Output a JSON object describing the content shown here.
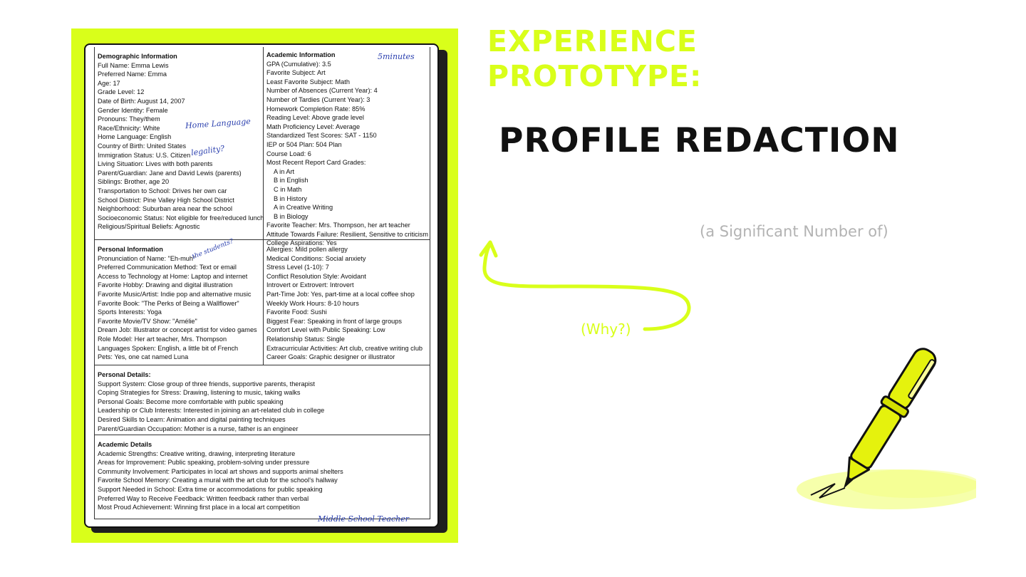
{
  "slide": {
    "title_line1": "EXPERIENCE",
    "title_line2": "PROTOTYPE:",
    "heading": "PROFILE REDACTION",
    "subtitle": "(a Significant Number of)",
    "why": "(Why?)",
    "accent_color": "#d9ff1a"
  },
  "doc": {
    "handwriting": {
      "time": "5minutes",
      "home_language": "Home Language",
      "legality": "legality?",
      "the_students": "the students?",
      "role": "Middle School Teacher"
    },
    "demographic": {
      "title": "Demographic Information",
      "lines": [
        "Full Name: Emma Lewis",
        "Preferred Name: Emma",
        "Age: 17",
        "Grade Level: 12",
        "Date of Birth: August 14, 2007",
        "Gender Identity: Female",
        "Pronouns: They/them",
        "Race/Ethnicity: White",
        "Home Language: English",
        "Country of Birth: United States",
        "Immigration Status: U.S. Citizen",
        "Living Situation: Lives with both parents",
        "Parent/Guardian: Jane and David Lewis (parents)",
        "Siblings: Brother, age 20",
        "Transportation to School: Drives her own car",
        "School District: Pine Valley High School District",
        "Neighborhood: Suburban area near the school",
        "Socioeconomic Status: Not eligible for free/reduced lunch",
        "Religious/Spiritual Beliefs: Agnostic"
      ]
    },
    "academic_info": {
      "title": "Academic Information",
      "lines": [
        "GPA (Cumulative): 3.5",
        "Favorite Subject: Art",
        "Least Favorite Subject: Math",
        "Number of Absences (Current Year): 4",
        "Number of Tardies (Current Year): 3",
        "Homework Completion Rate: 85%",
        "Reading Level: Above grade level",
        "Math Proficiency Level: Average",
        "Standardized Test Scores: SAT - 1150",
        "IEP or 504 Plan: 504 Plan",
        "Course Load: 6",
        "Most Recent Report Card Grades:"
      ],
      "grades": [
        "A in Art",
        "B in English",
        "C in Math",
        "B in History",
        "A in Creative Writing",
        "B in Biology"
      ],
      "after": [
        "Favorite Teacher: Mrs. Thompson, her art teacher",
        "Attitude Towards Failure: Resilient, Sensitive to criticism",
        "College Aspirations: Yes"
      ]
    },
    "personal_info": {
      "title": "Personal Information",
      "lines": [
        "Pronunciation of Name: \"Eh-muh\"",
        "Preferred Communication Method: Text or email",
        "Access to Technology at Home: Laptop and internet",
        "Favorite Hobby: Drawing and digital illustration",
        "Favorite Music/Artist: Indie pop and alternative music",
        "Favorite Book: \"The Perks of Being a Wallflower\"",
        "Sports Interests: Yoga",
        "Favorite Movie/TV Show: \"Amélie\"",
        "Dream Job: Illustrator or concept artist for video games",
        "Role Model: Her art teacher, Mrs. Thompson",
        "Languages Spoken: English, a little bit of French",
        "Pets: Yes, one cat named Luna"
      ]
    },
    "personal_right": {
      "lines": [
        "Allergies: Mild pollen allergy",
        "Medical Conditions: Social anxiety",
        "Stress Level (1-10): 7",
        "Conflict Resolution Style: Avoidant",
        "Introvert or Extrovert: Introvert",
        "Part-Time Job: Yes, part-time at a local coffee shop",
        "Weekly Work Hours: 8-10 hours",
        "Favorite Food: Sushi",
        "Biggest Fear: Speaking in front of large groups",
        "Comfort Level with Public Speaking: Low",
        "Relationship Status: Single",
        "Extracurricular Activities: Art club, creative writing club",
        "Career Goals: Graphic designer or illustrator"
      ]
    },
    "personal_details": {
      "title": "Personal Details:",
      "lines": [
        "Support System: Close group of three friends, supportive parents, therapist",
        "Coping Strategies for Stress: Drawing, listening to music, taking walks",
        "Personal Goals: Become more comfortable with public speaking",
        "Leadership or Club Interests: Interested in joining an art-related club in college",
        "Desired Skills to Learn: Animation and digital painting techniques",
        "Parent/Guardian Occupation: Mother is a nurse, father is an engineer"
      ]
    },
    "academic_details": {
      "title": "Academic Details",
      "lines": [
        "Academic Strengths: Creative writing, drawing, interpreting literature",
        "Areas for Improvement: Public speaking, problem-solving under pressure",
        "Community Involvement: Participates in local art shows and supports animal shelters",
        "Favorite School Memory: Creating a mural with the art club for the school's hallway",
        "Support Needed in School: Extra time or accommodations for public speaking",
        "Preferred Way to Receive Feedback: Written feedback rather than verbal",
        "Most Proud Achievement: Winning first place in a local art competition"
      ]
    }
  }
}
